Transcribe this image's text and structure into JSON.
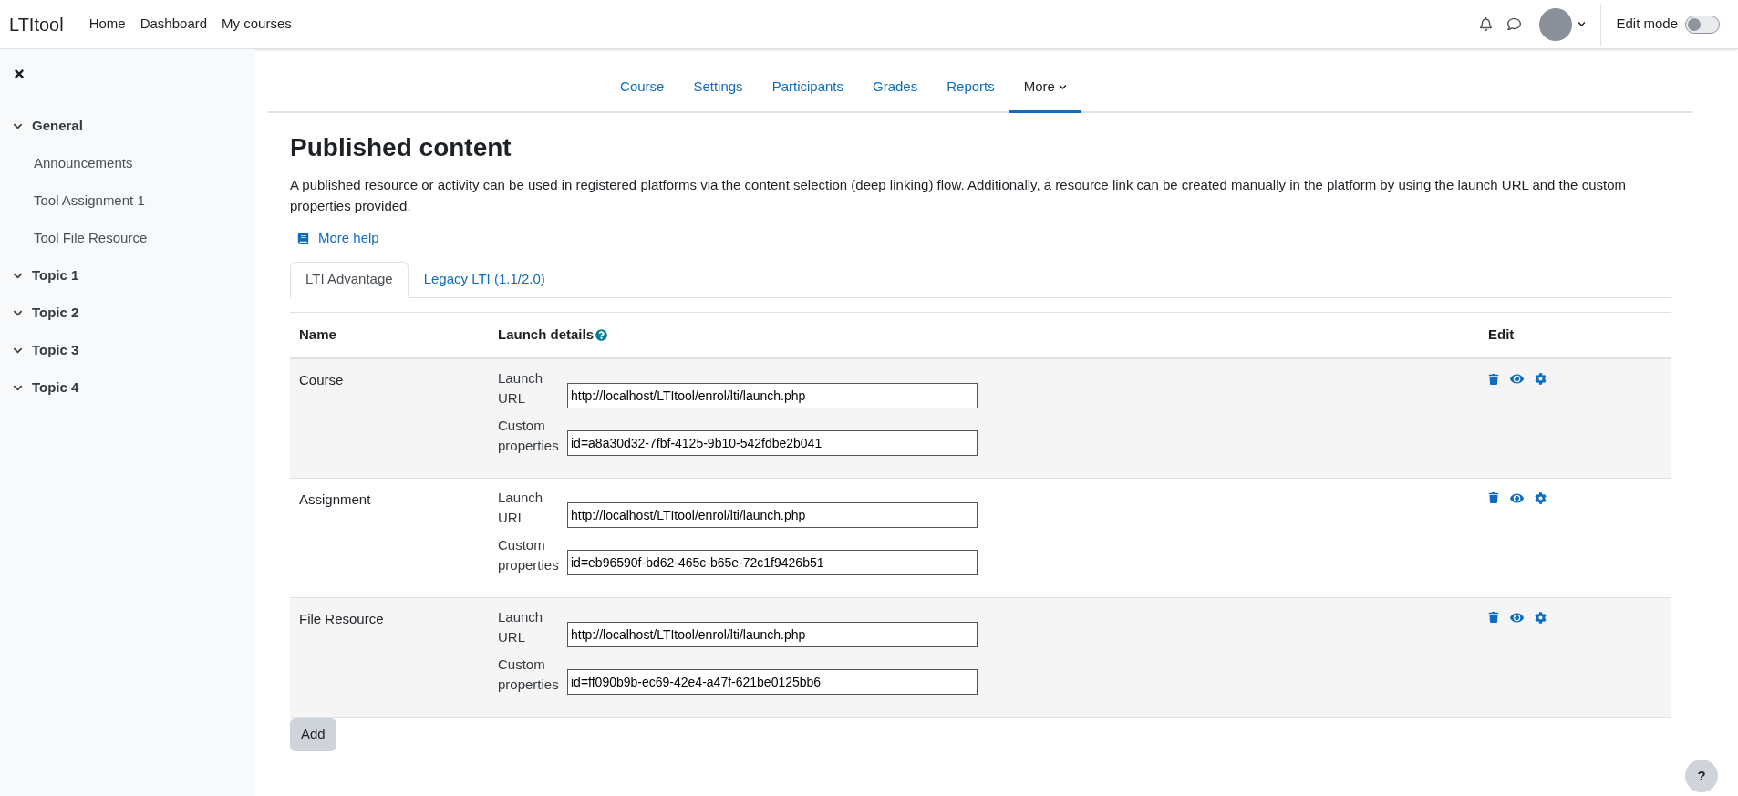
{
  "topbar": {
    "brand": "LTItool",
    "links": [
      "Home",
      "Dashboard",
      "My courses"
    ],
    "edit_mode": {
      "label": "Edit mode",
      "on": false
    }
  },
  "sidebar": {
    "items": [
      {
        "label": "General",
        "expanded": true,
        "children": [
          {
            "label": "Announcements"
          },
          {
            "label": "Tool Assignment 1"
          },
          {
            "label": "Tool File Resource"
          }
        ]
      },
      {
        "label": "Topic 1",
        "expanded": true
      },
      {
        "label": "Topic 2",
        "expanded": true
      },
      {
        "label": "Topic 3",
        "expanded": true
      },
      {
        "label": "Topic 4",
        "expanded": true
      }
    ]
  },
  "course_nav": [
    {
      "label": "Course",
      "selected": false
    },
    {
      "label": "Settings",
      "selected": false
    },
    {
      "label": "Participants",
      "selected": false
    },
    {
      "label": "Grades",
      "selected": false
    },
    {
      "label": "Reports",
      "selected": false
    },
    {
      "label": "More",
      "selected": true,
      "dropdown": true
    }
  ],
  "page": {
    "title": "Published content",
    "description": "A published resource or activity can be used in registered platforms via the content selection (deep linking) flow. Additionally, a resource link can be created manually in the platform by using the launch URL and the custom properties provided.",
    "help_link": "More help"
  },
  "tabs": [
    {
      "label": "LTI Advantage",
      "selected": true
    },
    {
      "label": "Legacy LTI (1.1/2.0)",
      "selected": false
    }
  ],
  "table": {
    "columns": [
      "Name",
      "Launch details",
      "Edit"
    ],
    "rows": [
      {
        "name": "Course",
        "launch_url_label": "Launch URL",
        "launch_url": "http://localhost/LTItool/enrol/lti/launch.php",
        "custom_label": "Custom properties",
        "custom": "id=a8a30d32-7fbf-4125-9b10-542fdbe2b041"
      },
      {
        "name": "Assignment",
        "launch_url_label": "Launch URL",
        "launch_url": "http://localhost/LTItool/enrol/lti/launch.php",
        "custom_label": "Custom properties",
        "custom": "id=eb96590f-bd62-465c-b65e-72c1f9426b51"
      },
      {
        "name": "File Resource",
        "launch_url_label": "Launch URL",
        "launch_url": "http://localhost/LTItool/enrol/lti/launch.php",
        "custom_label": "Custom properties",
        "custom": "id=ff090b9b-ec69-42e4-a47f-621be0125bb6"
      }
    ]
  },
  "add_button": "Add",
  "help_button": "?"
}
